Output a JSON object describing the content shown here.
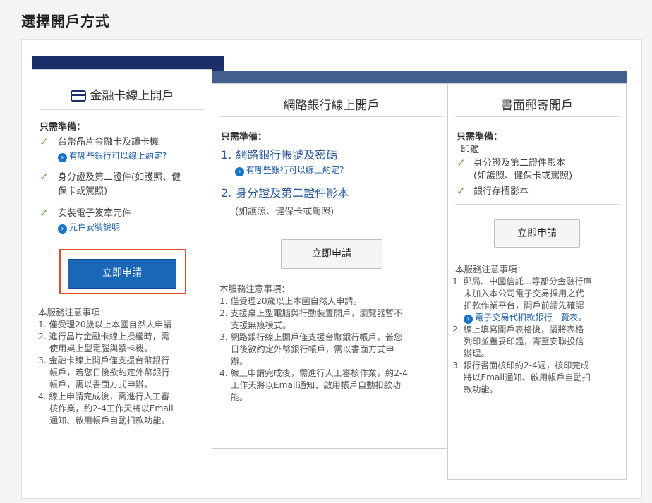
{
  "page_title": "選擇開戶方式",
  "cards": {
    "card1": {
      "title": "金融卡線上開戶",
      "prep_label": "只需準備：",
      "items": [
        {
          "text": "台幣晶片金融卡及讀卡機",
          "link": "有哪些銀行可以線上約定?"
        },
        {
          "text_line1": "身分證及第二證件(如護照、健",
          "text_line2": "保卡或駕照)"
        },
        {
          "text": "安裝電子簽章元件",
          "link": "元件安裝說明"
        }
      ],
      "button": "立即申請",
      "notes_title": "本服務注意事項：",
      "notes": [
        [
          "1. 僅受理20歲以上本國自然人申請"
        ],
        [
          "2. 進行晶片金融卡線上授權時，需",
          "   使用桌上型電腦與讀卡機。"
        ],
        [
          "3. 金融卡線上開戶僅支援台幣銀行",
          "   帳戶，若您日後欲約定外幣銀行",
          "   帳戶，需以書面方式申辦。"
        ],
        [
          "4. 線上申請完成後，需進行人工審",
          "   核作業，約2-4工作天將以Email",
          "   通知、啟用帳戶自動扣款功能。"
        ]
      ]
    },
    "card2": {
      "title": "網路銀行線上開戶",
      "prep_label": "只需準備：",
      "items": [
        {
          "num": "1.",
          "text": "網路銀行帳號及密碼",
          "link": "有哪些銀行可以線上約定?"
        },
        {
          "num": "2.",
          "text": "身分證及第二證件影本",
          "sub": "(如護照、健保卡或駕照)"
        }
      ],
      "button": "立即申請",
      "notes_title": "本服務注意事項：",
      "notes": [
        [
          "1. 僅受理20歲以上本國自然人申請。"
        ],
        [
          "2. 支援桌上型電腦與行動裝置開戶，瀏覽器暫不",
          "   支援無痕模式。"
        ],
        [
          "3. 網路銀行線上開戶僅支援台幣銀行帳戶，若您",
          "   日後欲約定外幣銀行帳戶，需以書面方式申",
          "   辦。"
        ],
        [
          "4. 線上申請完成後，需進行人工審核作業，約2-4",
          "   工作天將以Email通知、啟用帳戶自動扣款功",
          "   能。"
        ]
      ]
    },
    "card3": {
      "title": "書面郵寄開戶",
      "prep_label": "只需準備：",
      "seal": "印鑑",
      "items": [
        {
          "text_line1": "身分證及第二證件影本",
          "text_line2": "(如護照、健保卡或駕照)"
        },
        {
          "text": "銀行存摺影本"
        }
      ],
      "button": "立即申請",
      "notes_title": "本服務注意事項：",
      "notes": [
        [
          "1. 郵局、中國信託...等部分金融行庫",
          "   未加入本公司電子交易採用之代",
          "   扣款作業平台，開戶前請先確認"
        ],
        [
          "2. 線上填寫開戶表格後，請將表格",
          "   列印並蓋妥印鑑，寄至安聯投信",
          "   辦理。"
        ],
        [
          "3. 銀行書面核印約2-4週，核印完成",
          "   將以Email通知、啟用帳戶自動扣",
          "   款功能。"
        ]
      ],
      "notes_link": "電子交易代扣款銀行一覽表。"
    }
  },
  "colors": {
    "dark_band": "#1b2f6b",
    "blue_band": "#44608f",
    "primary_button": "#1a66b7",
    "link": "#1f5fa6",
    "check": "#5a9e2f",
    "highlight": "#e04b2a"
  },
  "icons": [
    "card-icon",
    "check-icon",
    "arrow-right-circle-icon"
  ]
}
